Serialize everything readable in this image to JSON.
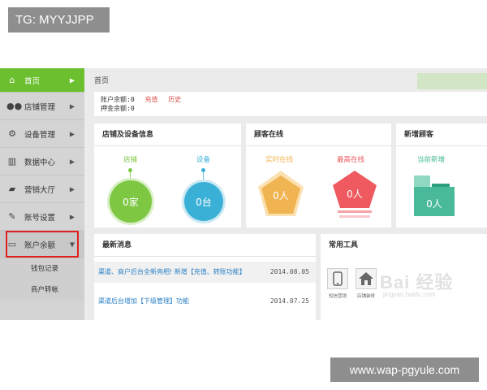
{
  "overlay": {
    "tg_label": "TG: MYYJJPP",
    "url_watermark": "www.wap-pgyule.com",
    "baidu_mark": "Bai 经验",
    "baidu_sub": "jingyan.baidu.com"
  },
  "sidebar": {
    "items": [
      {
        "label": "首页",
        "icon": "home-icon",
        "active": true
      },
      {
        "label": "店铺管理",
        "icon": "users-icon"
      },
      {
        "label": "设备管理",
        "icon": "cogs-icon"
      },
      {
        "label": "数据中心",
        "icon": "chart-icon"
      },
      {
        "label": "营销大厅",
        "icon": "briefcase-icon"
      },
      {
        "label": "账号设置",
        "icon": "wrench-icon"
      },
      {
        "label": "账户余额",
        "icon": "card-icon",
        "expanded": true
      }
    ],
    "sub_items": [
      "钱包记录",
      "商户转帐"
    ]
  },
  "header": {
    "breadcrumb": "首页"
  },
  "account": {
    "balance": "账户余额:0",
    "deposit": "押金余额:0",
    "recharge_link": "充值",
    "history_link": "历史"
  },
  "store_panel": {
    "title": "店铺及设备信息",
    "store_label": "店铺",
    "store_value": "0家",
    "device_label": "设备",
    "device_value": "0台"
  },
  "visitor_panel": {
    "title": "顾客在线",
    "realtime_label": "实时在线",
    "realtime_value": "0人",
    "peak_label": "最高在线",
    "peak_value": "0人"
  },
  "new_panel": {
    "title": "新增顾客",
    "today_label": "当前新增",
    "today_value": "0人"
  },
  "news_panel": {
    "title": "最新消息",
    "items": [
      {
        "title": "渠道、商户后台全新亮相! 新增【充值、转账功能】",
        "date": "2014.08.05"
      },
      {
        "title": "渠道后台增加【下级管理】功能",
        "date": "2014.07.25"
      }
    ]
  },
  "tools_panel": {
    "title": "常用工具",
    "tools": [
      {
        "label": "短信营销",
        "icon": "phone-icon"
      },
      {
        "label": "店铺装修",
        "icon": "house-icon"
      }
    ]
  },
  "colors": {
    "accent_green": "#6cbf2f",
    "store_circle": "#7dc743",
    "device_circle": "#3bb0d6",
    "realtime": "#f0b452",
    "peak": "#ee5a5f",
    "new_customer": "#49b99a"
  }
}
